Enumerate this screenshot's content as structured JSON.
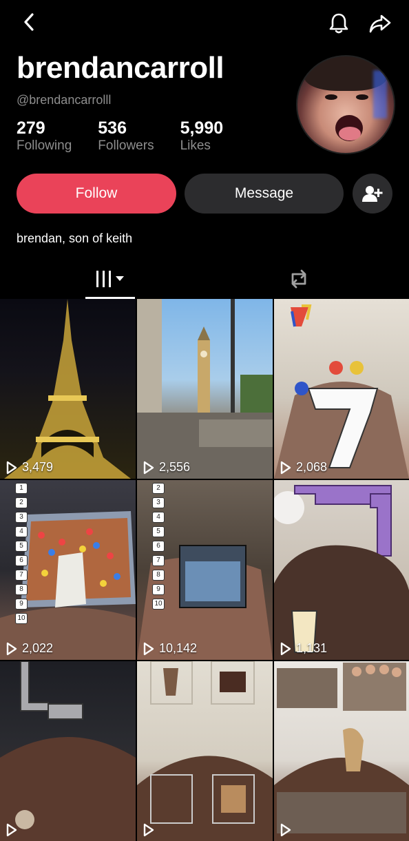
{
  "profile": {
    "display_name": "brendancarroll",
    "handle": "@brendancarrolll",
    "bio": "brendan, son of keith",
    "stats": [
      {
        "value": "279",
        "label": "Following"
      },
      {
        "value": "536",
        "label": "Followers"
      },
      {
        "value": "5,990",
        "label": "Likes"
      }
    ]
  },
  "actions": {
    "follow_label": "Follow",
    "message_label": "Message",
    "follow_color": "#ea4359"
  },
  "icons": {
    "back": "chevron-left-icon",
    "bell": "bell-icon",
    "share": "share-icon",
    "add_user": "add-user-icon",
    "videos_tab": "grid-videos-icon",
    "reposts_tab": "repost-icon",
    "play": "play-icon"
  },
  "videos": [
    {
      "views": "3,479"
    },
    {
      "views": "2,556"
    },
    {
      "views": "2,068"
    },
    {
      "views": "2,022"
    },
    {
      "views": "10,142"
    },
    {
      "views": "1,131"
    },
    {
      "views": ""
    },
    {
      "views": ""
    },
    {
      "views": ""
    }
  ]
}
